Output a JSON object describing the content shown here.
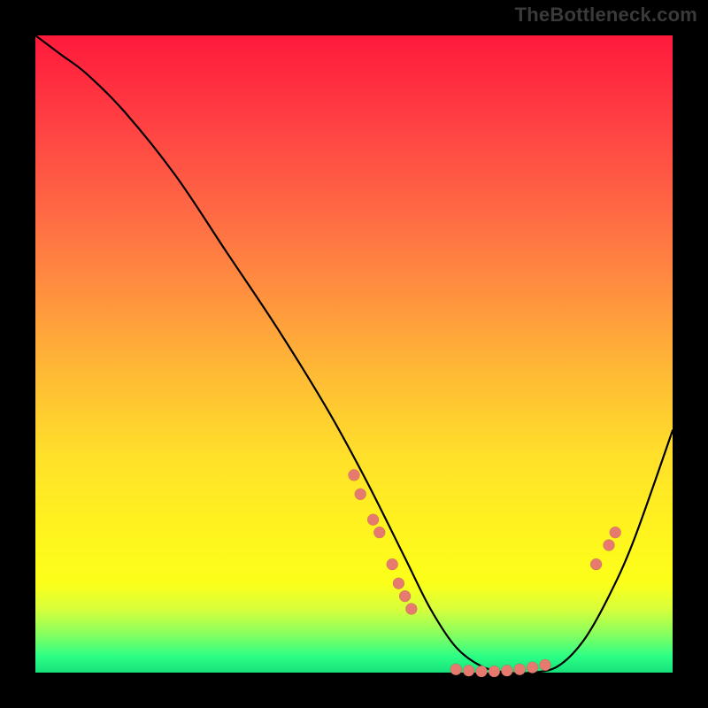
{
  "watermark": "TheBottleneck.com",
  "colors": {
    "background": "#000000",
    "dot_fill": "#e67a6e",
    "curve_stroke": "#000000"
  },
  "chart_data": {
    "type": "line",
    "title": "",
    "xlabel": "",
    "ylabel": "",
    "xlim": [
      0,
      100
    ],
    "ylim": [
      0,
      100
    ],
    "grid": false,
    "legend": false,
    "series": [
      {
        "name": "bottleneck-curve",
        "x": [
          0,
          4,
          8,
          14,
          22,
          30,
          38,
          46,
          52,
          58,
          62,
          66,
          70,
          74,
          78,
          82,
          86,
          90,
          94,
          100
        ],
        "y": [
          100,
          97,
          94,
          88,
          78,
          66,
          54,
          41,
          30,
          18,
          10,
          4,
          1,
          0,
          0,
          1,
          5,
          12,
          21,
          38
        ]
      }
    ],
    "markers": [
      {
        "x": 50,
        "y": 31
      },
      {
        "x": 51,
        "y": 28
      },
      {
        "x": 53,
        "y": 24
      },
      {
        "x": 54,
        "y": 22
      },
      {
        "x": 56,
        "y": 17
      },
      {
        "x": 57,
        "y": 14
      },
      {
        "x": 58,
        "y": 12
      },
      {
        "x": 59,
        "y": 10
      },
      {
        "x": 66,
        "y": 0.5
      },
      {
        "x": 68,
        "y": 0.3
      },
      {
        "x": 70,
        "y": 0.2
      },
      {
        "x": 72,
        "y": 0.2
      },
      {
        "x": 74,
        "y": 0.3
      },
      {
        "x": 76,
        "y": 0.5
      },
      {
        "x": 78,
        "y": 0.8
      },
      {
        "x": 80,
        "y": 1.2
      },
      {
        "x": 88,
        "y": 17
      },
      {
        "x": 90,
        "y": 20
      },
      {
        "x": 91,
        "y": 22
      }
    ],
    "annotations": []
  }
}
